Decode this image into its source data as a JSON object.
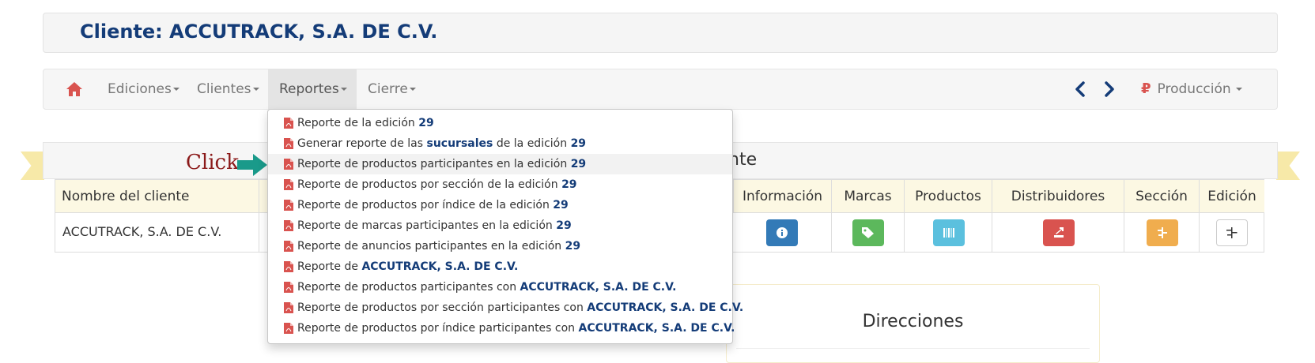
{
  "header": {
    "title": "Cliente: ACCUTRACK, S.A. DE C.V."
  },
  "navbar": {
    "items": [
      {
        "label": "Ediciones"
      },
      {
        "label": "Clientes"
      },
      {
        "label": "Reportes"
      },
      {
        "label": "Cierre"
      }
    ],
    "environment": "Producción",
    "icons": [
      "home-icon",
      "chevron-left-icon",
      "chevron-right-icon",
      "ruble-icon"
    ]
  },
  "section": {
    "title_visible": "nte"
  },
  "table": {
    "columns": [
      "Nombre del cliente",
      "Información",
      "Marcas",
      "Productos",
      "Distribuidores",
      "Sección",
      "Edición"
    ],
    "row": {
      "client_name": "ACCUTRACK, S.A. DE C.V."
    },
    "button_colors": {
      "info": "#337ab7",
      "marcas": "#5cb85c",
      "productos": "#5bc0de",
      "distribuidores": "#d9534f",
      "seccion": "#f0ad4e",
      "edicion": "#ffffff"
    }
  },
  "direcciones": {
    "title": "Direcciones"
  },
  "annotation": {
    "click": "Click"
  },
  "dropdown": {
    "items": [
      {
        "pre": "Reporte de la edición ",
        "bold": "29",
        "post": ""
      },
      {
        "pre": "Generar reporte de las ",
        "bold": "sucursales",
        "post": " de la edición ",
        "bold2": "29"
      },
      {
        "pre": "Reporte de productos participantes en la edición ",
        "bold": "29",
        "post": ""
      },
      {
        "pre": "Reporte de productos por sección de la edición ",
        "bold": "29",
        "post": ""
      },
      {
        "pre": "Reporte de productos por índice de la edición ",
        "bold": "29",
        "post": ""
      },
      {
        "pre": "Reporte de marcas participantes en la edición ",
        "bold": "29",
        "post": ""
      },
      {
        "pre": "Reporte de anuncios participantes en la edición ",
        "bold": "29",
        "post": ""
      },
      {
        "pre": "Reporte de ",
        "bold": "ACCUTRACK, S.A. DE C.V.",
        "post": ""
      },
      {
        "pre": "Reporte de productos participantes con ",
        "bold": "ACCUTRACK, S.A. DE C.V.",
        "post": ""
      },
      {
        "pre": "Reporte de productos por sección participantes con ",
        "bold": "ACCUTRACK, S.A. DE C.V.",
        "post": ""
      },
      {
        "pre": "Reporte de productos por índice participantes con ",
        "bold": "ACCUTRACK, S.A. DE C.V.",
        "post": ""
      }
    ]
  },
  "colors": {
    "accent": "#143c78",
    "danger": "#d9534f",
    "highlight": "#fcf8e3",
    "arrow": "#1a9a8a"
  }
}
